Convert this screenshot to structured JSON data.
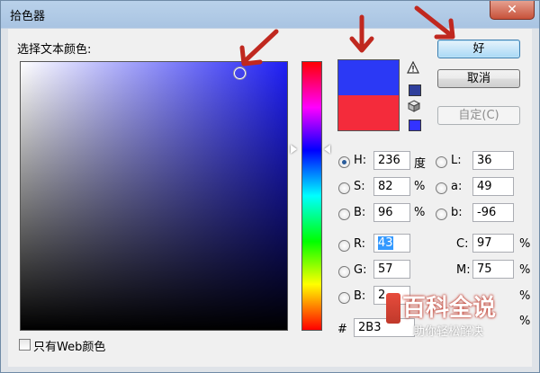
{
  "window": {
    "title": "拾色器",
    "close_glyph": "✕"
  },
  "picker": {
    "label": "选择文本颜色:"
  },
  "colors": {
    "new": "#2b39f5",
    "current": "#f42b3b",
    "gamut_swatch": "#2f3f9c",
    "web_swatch": "#3333ff",
    "hue_marker_position": 0.33,
    "sv_cursor": {
      "saturation": 0.82,
      "brightness": 0.96
    }
  },
  "buttons": {
    "ok": "好",
    "cancel": "取消",
    "custom": "自定(C)"
  },
  "icons": {
    "warning": "warning-triangle-icon",
    "cube": "web-safe-cube-icon"
  },
  "hsb": {
    "h": {
      "label": "H:",
      "value": "236",
      "unit": "度",
      "selected": true
    },
    "s": {
      "label": "S:",
      "value": "82",
      "unit": "%"
    },
    "b": {
      "label": "B:",
      "value": "96",
      "unit": "%"
    }
  },
  "lab": {
    "l": {
      "label": "L:",
      "value": "36"
    },
    "a": {
      "label": "a:",
      "value": "49"
    },
    "b": {
      "label": "b:",
      "value": "-96"
    }
  },
  "rgb": {
    "r": {
      "label": "R:",
      "value": "43"
    },
    "g": {
      "label": "G:",
      "value": "57"
    },
    "b": {
      "label": "B:",
      "value": "2"
    }
  },
  "cmyk": {
    "c": {
      "label": "C:",
      "value": "97",
      "unit": "%"
    },
    "m": {
      "label": "M:",
      "value": "75",
      "unit": "%"
    },
    "y_unit": "%",
    "k_unit": "%"
  },
  "hex": {
    "label": "#",
    "value": "2B3"
  },
  "web_only": {
    "label": "只有Web颜色"
  },
  "watermark": {
    "main": "百科全说",
    "sub": "助你轻松解决"
  },
  "annotation_color": "#c0281f"
}
